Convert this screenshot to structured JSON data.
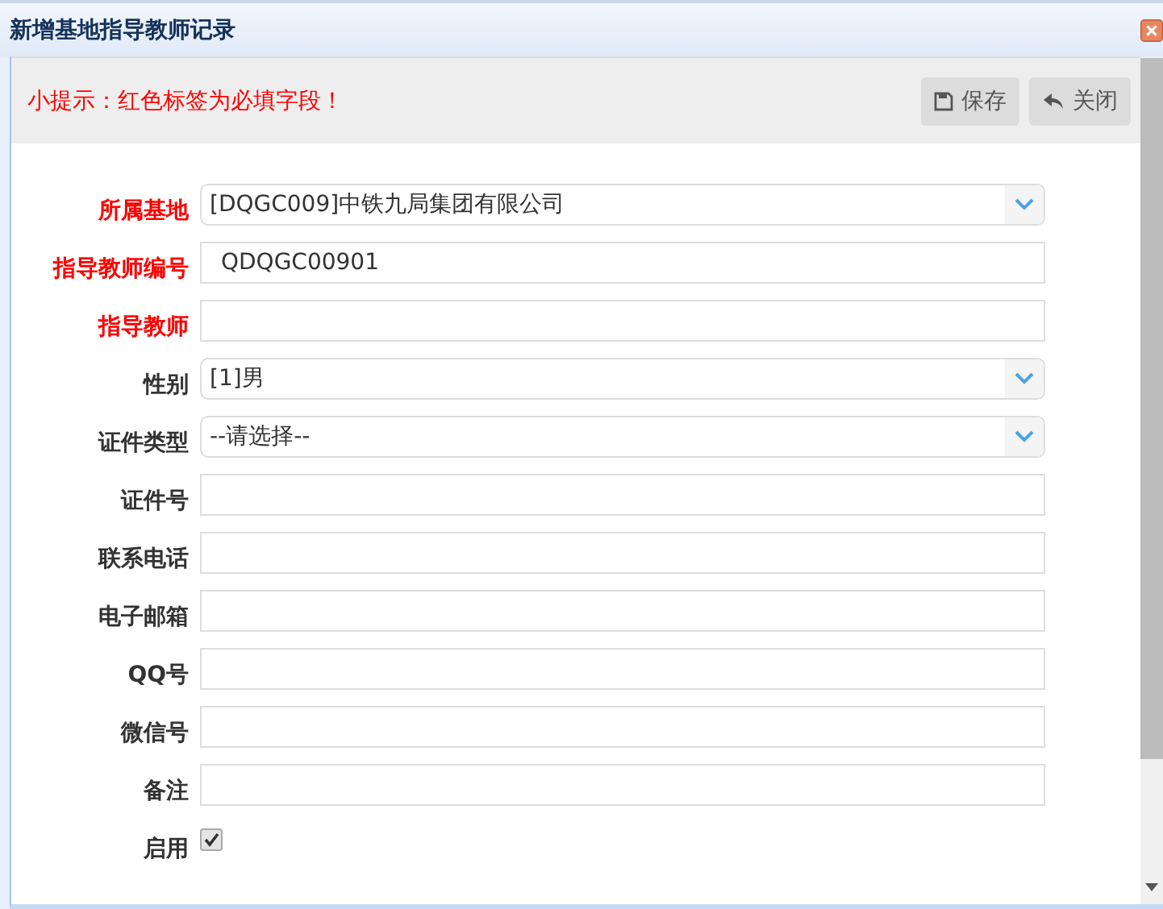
{
  "window": {
    "title": "新增基地指导教师记录"
  },
  "toolbar": {
    "hint": "小提示：红色标签为必填字段！",
    "buttons": [
      {
        "label": "保存",
        "kind": "save"
      },
      {
        "label": "关闭",
        "kind": "close"
      }
    ]
  },
  "fields": [
    {
      "label": "所属基地",
      "kind": "select",
      "required": true,
      "value": "[DQGC009]中铁九局集团有限公司"
    },
    {
      "label": "指导教师编号",
      "kind": "text",
      "required": true,
      "value": "QDQGC00901"
    },
    {
      "label": "指导教师",
      "kind": "text",
      "required": true
    },
    {
      "label": "性别",
      "kind": "select",
      "required": false,
      "value": "[1]男"
    },
    {
      "label": "证件类型",
      "kind": "select",
      "required": false,
      "value": "--请选择--"
    },
    {
      "label": "证件号",
      "kind": "text",
      "required": false
    },
    {
      "label": "联系电话",
      "kind": "text",
      "required": false
    },
    {
      "label": "电子邮箱",
      "kind": "text",
      "required": false
    },
    {
      "label": "QQ号",
      "kind": "text",
      "required": false
    },
    {
      "label": "微信号",
      "kind": "text",
      "required": false
    },
    {
      "label": "备注",
      "kind": "text",
      "required": false
    },
    {
      "label": "启用",
      "kind": "checkbox",
      "required": false,
      "checked": true
    }
  ]
}
